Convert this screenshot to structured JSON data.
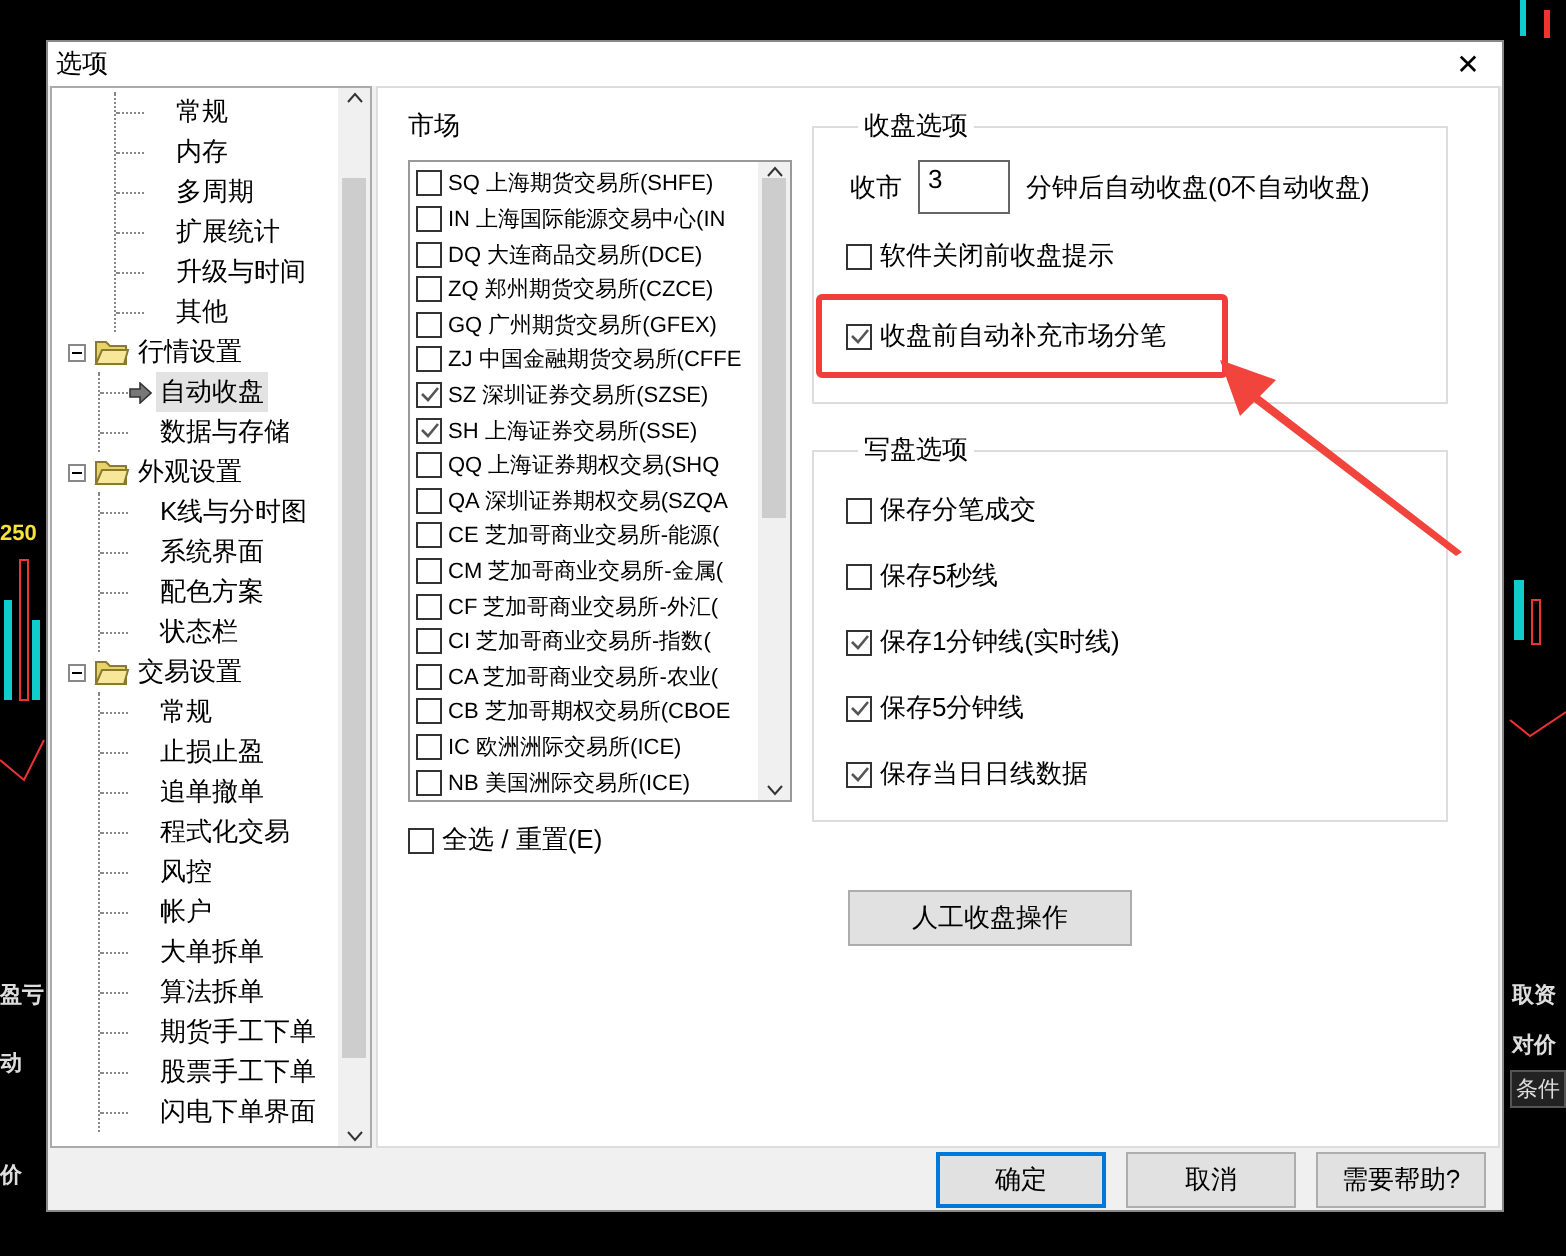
{
  "background": {
    "texts": [
      {
        "text": "250",
        "kind": "value"
      },
      {
        "text": "盈亏",
        "kind": "label"
      },
      {
        "text": "动",
        "kind": "label"
      },
      {
        "text": "价",
        "kind": "label"
      },
      {
        "text": "取资",
        "kind": "label"
      },
      {
        "text": "对价",
        "kind": "label"
      },
      {
        "text": "条件",
        "kind": "tab"
      }
    ]
  },
  "dialog": {
    "title": "选项",
    "close": "✕",
    "tree": [
      {
        "children": [
          {
            "label": "常规",
            "selected": false
          },
          {
            "label": "内存",
            "selected": false
          },
          {
            "label": "多周期",
            "selected": false
          },
          {
            "label": "扩展统计",
            "selected": false
          },
          {
            "label": "升级与时间",
            "selected": false
          },
          {
            "label": "其他",
            "selected": false
          }
        ]
      },
      {
        "label": "行情设置",
        "expanded": true,
        "children": [
          {
            "label": "自动收盘",
            "selected": true
          },
          {
            "label": "数据与存储",
            "selected": false
          }
        ]
      },
      {
        "label": "外观设置",
        "expanded": true,
        "children": [
          {
            "label": "K线与分时图",
            "selected": false
          },
          {
            "label": "系统界面",
            "selected": false
          },
          {
            "label": "配色方案",
            "selected": false
          },
          {
            "label": "状态栏",
            "selected": false
          }
        ]
      },
      {
        "label": "交易设置",
        "expanded": true,
        "children": [
          {
            "label": "常规",
            "selected": false
          },
          {
            "label": "止损止盈",
            "selected": false
          },
          {
            "label": "追单撤单",
            "selected": false
          },
          {
            "label": "程式化交易",
            "selected": false
          },
          {
            "label": "风控",
            "selected": false
          },
          {
            "label": "帐户",
            "selected": false
          },
          {
            "label": "大单拆单",
            "selected": false
          },
          {
            "label": "算法拆单",
            "selected": false
          },
          {
            "label": "期货手工下单",
            "selected": false
          },
          {
            "label": "股票手工下单",
            "selected": false
          },
          {
            "label": "闪电下单界面",
            "selected": false
          }
        ]
      }
    ],
    "markets": {
      "title": "市场",
      "items": [
        {
          "label": "SQ 上海期货交易所(SHFE)",
          "checked": false
        },
        {
          "label": "IN 上海国际能源交易中心(IN",
          "checked": false
        },
        {
          "label": "DQ 大连商品交易所(DCE)",
          "checked": false
        },
        {
          "label": "ZQ 郑州期货交易所(CZCE)",
          "checked": false
        },
        {
          "label": "GQ 广州期货交易所(GFEX)",
          "checked": false
        },
        {
          "label": "ZJ 中国金融期货交易所(CFFE",
          "checked": false
        },
        {
          "label": "SZ 深圳证券交易所(SZSE)",
          "checked": true
        },
        {
          "label": "SH 上海证券交易所(SSE)",
          "checked": true
        },
        {
          "label": "QQ 上海证券期权交易(SHQ",
          "checked": false
        },
        {
          "label": "QA 深圳证券期权交易(SZQA",
          "checked": false
        },
        {
          "label": "CE 芝加哥商业交易所-能源(",
          "checked": false
        },
        {
          "label": "CM 芝加哥商业交易所-金属(",
          "checked": false
        },
        {
          "label": "CF 芝加哥商业交易所-外汇(",
          "checked": false
        },
        {
          "label": "CI 芝加哥商业交易所-指数(",
          "checked": false
        },
        {
          "label": "CA 芝加哥商业交易所-农业(",
          "checked": false
        },
        {
          "label": "CB 芝加哥期权交易所(CBOE",
          "checked": false
        },
        {
          "label": "IC 欧洲洲际交易所(ICE)",
          "checked": false
        },
        {
          "label": "NB 美国洲际交易所(ICE)",
          "checked": false
        }
      ],
      "select_all": {
        "label": "全选 / 重置(E)",
        "checked": false
      }
    },
    "close_options": {
      "title": "收盘选项",
      "minutes_label": "收市",
      "minutes": "3",
      "minutes_suffix": "分钟后自动收盘(0不自动收盘)",
      "options": [
        {
          "label": "软件关闭前收盘提示",
          "checked": false,
          "highlighted": false
        },
        {
          "label": "收盘前自动补充市场分笔",
          "checked": true,
          "highlighted": true
        }
      ]
    },
    "write_options": {
      "title": "写盘选项",
      "options": [
        {
          "label": "保存分笔成交",
          "checked": false
        },
        {
          "label": "保存5秒线",
          "checked": false
        },
        {
          "label": "保存1分钟线(实时线)",
          "checked": true
        },
        {
          "label": "保存5分钟线",
          "checked": true
        },
        {
          "label": "保存当日日线数据",
          "checked": true
        }
      ]
    },
    "manual_button": "人工收盘操作",
    "buttons": [
      {
        "label": "确定",
        "default": true
      },
      {
        "label": "取消",
        "default": false
      },
      {
        "label": "需要帮助?",
        "default": false
      }
    ]
  }
}
